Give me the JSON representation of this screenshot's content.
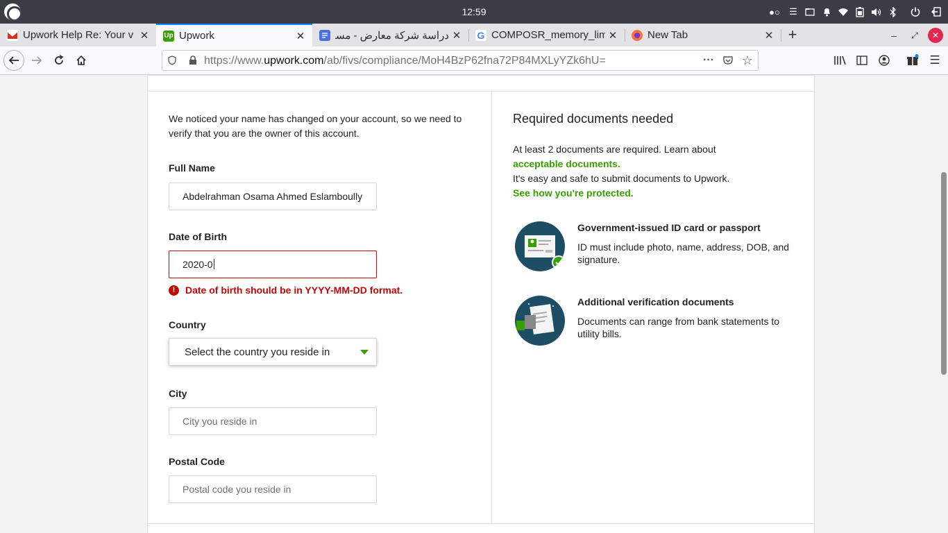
{
  "os": {
    "clock": "12:59",
    "tray_icons": [
      "record-toggle-icon",
      "menu-icon",
      "folder-icon",
      "notification-bell-icon",
      "wifi-icon",
      "battery-icon",
      "volume-icon",
      "bluetooth-icon",
      "power-icon",
      "logout-icon"
    ]
  },
  "tabs": [
    {
      "title": "Upwork Help Re: Your v",
      "favicon": "gmail-icon",
      "active": false
    },
    {
      "title": "Upwork",
      "favicon": "upwork-icon",
      "active": true
    },
    {
      "title": "دراسة شركة معارض - مستن",
      "favicon": "docs-icon",
      "active": false
    },
    {
      "title": "COMPOSR_memory_limi",
      "favicon": "google-icon",
      "active": false
    },
    {
      "title": "New Tab",
      "favicon": "firefox-icon",
      "active": false
    }
  ],
  "browser": {
    "url_prefix": "https://www.",
    "url_domain": "upwork.com",
    "url_path": "/ab/fivs/compliance/MoH4BzP62fna72P84MXLyYZk6hU="
  },
  "form": {
    "intro": "We noticed your name has changed on your account, so we need to verify that you are the owner of this account.",
    "full_name_label": "Full Name",
    "full_name_value": "Abdelrahman Osama Ahmed Eslamboully",
    "dob_label": "Date of Birth",
    "dob_value": "2020-0",
    "dob_error": "Date of birth should be in YYYY-MM-DD format.",
    "country_label": "Country",
    "country_selected": "Select the country you reside in",
    "city_label": "City",
    "city_placeholder": "City you reside in",
    "postal_label": "Postal Code",
    "postal_placeholder": "Postal code you reside in"
  },
  "requirements": {
    "title": "Required documents needed",
    "line1": "At least 2 documents are required. Learn about ",
    "link1": "acceptable documents.",
    "line2": "It's easy and safe to submit documents to Upwork.",
    "link2": "See how you're protected.",
    "docs": [
      {
        "title": "Government-issued ID card or passport",
        "desc": "ID must include photo, name, address, DOB, and signature.",
        "icon": "id-card-icon"
      },
      {
        "title": "Additional verification documents",
        "desc": "Documents can range from bank statements to utility bills.",
        "icon": "document-icon"
      }
    ]
  },
  "colors": {
    "accent": "#37a000",
    "error": "#c30505",
    "tab_highlight": "#0a84ff",
    "icon_bg": "#1e4e63"
  }
}
